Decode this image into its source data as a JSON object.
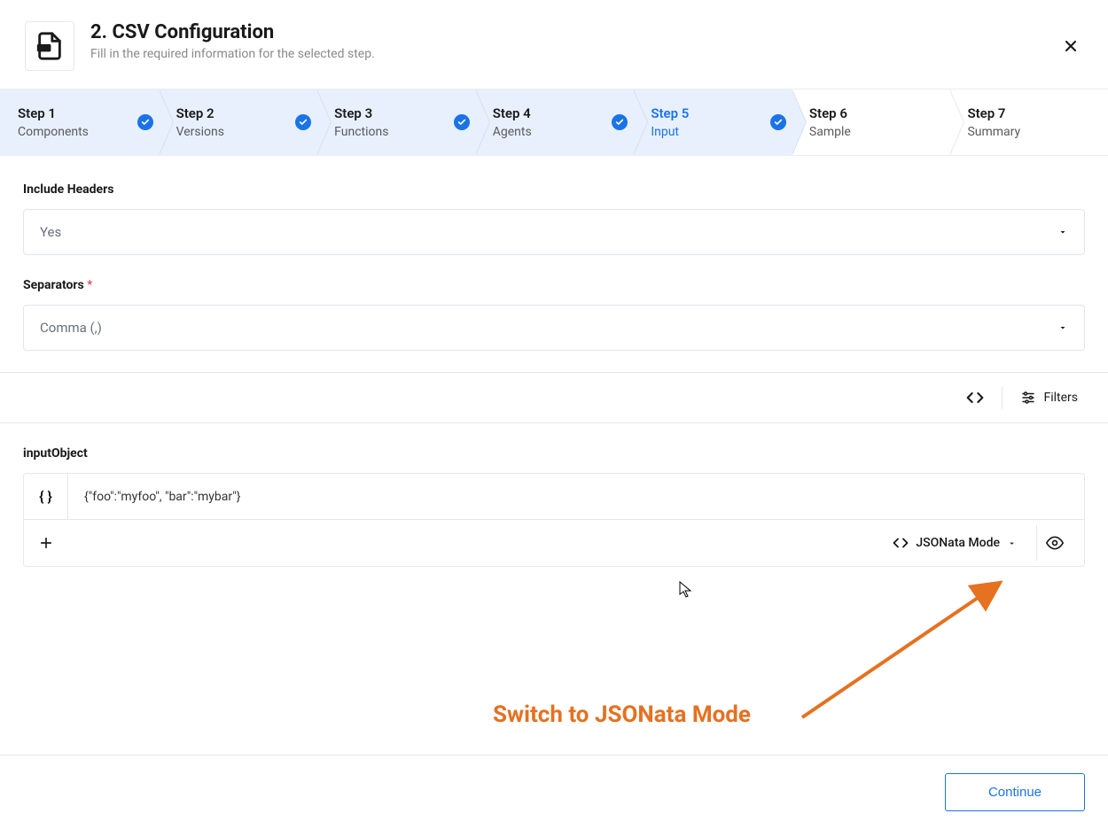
{
  "header": {
    "title": "2. CSV Configuration",
    "subtitle": "Fill in the required information for the selected step."
  },
  "steps": [
    {
      "title": "Step 1",
      "label": "Components",
      "checked": true,
      "active": false,
      "future": false
    },
    {
      "title": "Step 2",
      "label": "Versions",
      "checked": true,
      "active": false,
      "future": false
    },
    {
      "title": "Step 3",
      "label": "Functions",
      "checked": true,
      "active": false,
      "future": false
    },
    {
      "title": "Step 4",
      "label": "Agents",
      "checked": true,
      "active": false,
      "future": false
    },
    {
      "title": "Step 5",
      "label": "Input",
      "checked": true,
      "active": true,
      "future": false
    },
    {
      "title": "Step 6",
      "label": "Sample",
      "checked": false,
      "active": false,
      "future": true
    },
    {
      "title": "Step 7",
      "label": "Summary",
      "checked": false,
      "active": false,
      "future": true
    }
  ],
  "form": {
    "includeHeadersLabel": "Include Headers",
    "includeHeadersValue": "Yes",
    "separatorsLabel": "Separators",
    "separatorsValue": "Comma (,)"
  },
  "toolbar": {
    "filtersLabel": "Filters"
  },
  "inputObject": {
    "label": "inputObject",
    "value": "{\"foo\":\"myfoo\", \"bar\":\"mybar\"}",
    "modeLabel": "JSONata Mode"
  },
  "annotation": "Switch to JSONata Mode",
  "footer": {
    "continueLabel": "Continue"
  }
}
